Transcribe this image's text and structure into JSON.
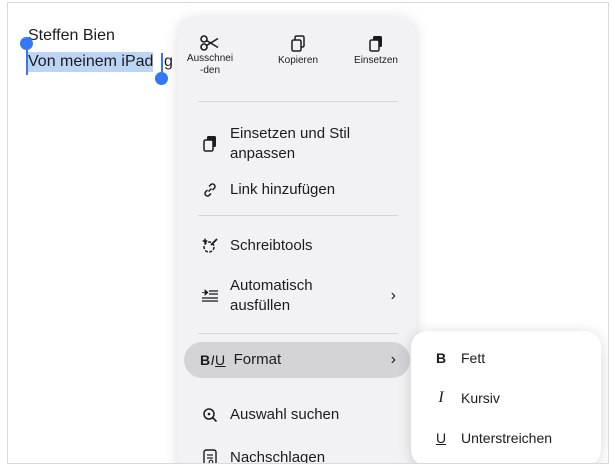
{
  "document": {
    "line1": "Steffen Bien",
    "line2_selected": "Von meinem iPad",
    "line2_rest": "g"
  },
  "menu": {
    "toolbar": [
      {
        "label": "Ausschnei-den",
        "icon": "scissors-icon"
      },
      {
        "label": "Kopieren",
        "icon": "copy-icon"
      },
      {
        "label": "Einsetzen",
        "icon": "paste-icon"
      }
    ],
    "items": {
      "paste_style": "Einsetzen und Stil anpassen",
      "add_link": "Link hinzufügen",
      "writing_tools": "Schreibtools",
      "autofill": "Automatisch ausfüllen",
      "format": "Format",
      "format_glyph": "BIU",
      "look_up_selection": "Auswahl suchen",
      "look_up": "Nachschlagen"
    },
    "chevron": "›"
  },
  "submenu": {
    "items": [
      {
        "glyph": "B",
        "label": "Fett"
      },
      {
        "glyph": "I",
        "label": "Kursiv"
      },
      {
        "glyph": "U",
        "label": "Unterstreichen"
      }
    ]
  }
}
